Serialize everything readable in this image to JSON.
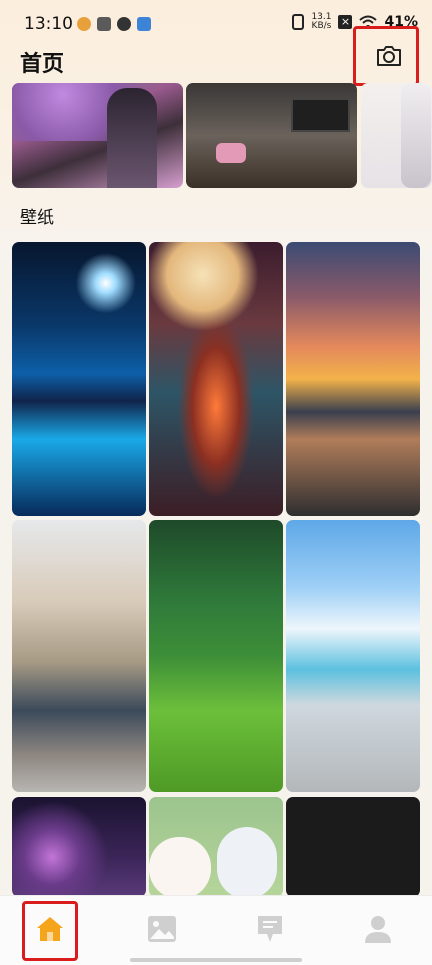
{
  "status_bar": {
    "time": "13:10",
    "net_speed_value": "13.1",
    "net_speed_unit": "KB/s",
    "battery_text": "41%"
  },
  "header": {
    "title": "首页",
    "camera_icon": "camera-icon"
  },
  "banners": [
    {
      "icon": "image"
    },
    {
      "icon": "image"
    },
    {
      "icon": "image"
    }
  ],
  "section": {
    "title": "壁纸"
  },
  "nav": {
    "items": [
      {
        "icon": "home-icon",
        "active": true
      },
      {
        "icon": "image-icon",
        "active": false
      },
      {
        "icon": "feedback-icon",
        "active": false
      },
      {
        "icon": "user-icon",
        "active": false
      }
    ]
  },
  "colors": {
    "accent": "#f4a51c",
    "highlight_box": "#d91c1c",
    "inactive_icon": "#cfcfcf"
  }
}
